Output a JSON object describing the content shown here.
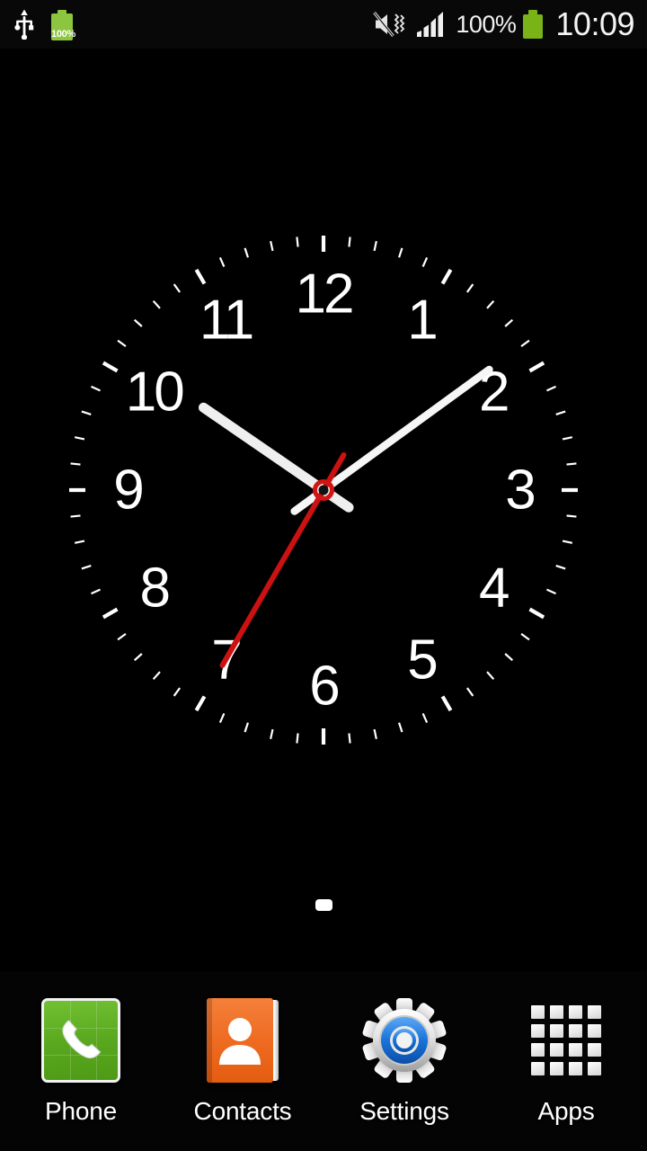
{
  "status_bar": {
    "usb_icon": "usb-icon",
    "battery_left": {
      "icon": "battery-icon",
      "percent_label": "100%",
      "color": "#8cc63e"
    },
    "mute_icon": "mute-vibrate-icon",
    "signal_icon": "signal-bars-icon",
    "signal_bars_filled": 4,
    "battery_percent_label": "100%",
    "battery_right": {
      "icon": "battery-icon",
      "color": "#7ab317"
    },
    "clock": "10:09"
  },
  "clock_widget": {
    "name": "analog-clock-widget",
    "hour_numerals": [
      "12",
      "1",
      "2",
      "3",
      "4",
      "5",
      "6",
      "7",
      "8",
      "9",
      "10",
      "11"
    ],
    "time": {
      "hours": 10,
      "minutes": 9,
      "seconds": 35
    },
    "hands": {
      "hour_angle_deg": 304.5,
      "minute_angle_deg": 54,
      "second_angle_deg": 210
    },
    "colors": {
      "face": "#0a0a0a",
      "numerals": "#ffffff",
      "ticks": "#ffffff",
      "hour_hand": "#f0f0f0",
      "minute_hand": "#f5f5f5",
      "second_hand": "#cc1111",
      "hub": "#d11414"
    },
    "tick_count": 60
  },
  "page_indicator": {
    "total_pages": 1,
    "active_page": 1
  },
  "dock": {
    "items": [
      {
        "label": "Phone",
        "icon": "phone-handset-icon",
        "color": "#5aa81f"
      },
      {
        "label": "Contacts",
        "icon": "contacts-book-icon",
        "color": "#ef6b22"
      },
      {
        "label": "Settings",
        "icon": "gear-icon",
        "color": "#1a73d8"
      },
      {
        "label": "Apps",
        "icon": "app-grid-icon",
        "color": "#e8e8e8"
      }
    ]
  }
}
